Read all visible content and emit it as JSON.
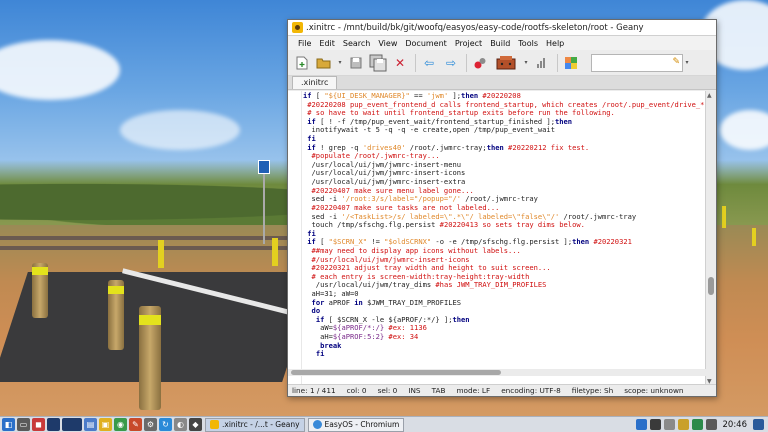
{
  "window": {
    "title": ".xinitrc - /mnt/build/bk/git/woofq/easyos/easy-code/rootfs-skeleton/root - Geany"
  },
  "menu": [
    "File",
    "Edit",
    "Search",
    "View",
    "Document",
    "Project",
    "Build",
    "Tools",
    "Help"
  ],
  "toolbar": {
    "icons": [
      "new-file-icon",
      "open-file-icon",
      "save-icon",
      "close-icon",
      "save-all-icon",
      "back-icon",
      "forward-icon",
      "compile-icon",
      "build-icon",
      "run-icon",
      "color-chooser-icon"
    ],
    "search_value": ""
  },
  "tab": {
    "label": ".xinitrc"
  },
  "code_lines": [
    [
      [
        "k",
        "if"
      ],
      [
        "n",
        " [ "
      ],
      [
        "s",
        "\"${UI_DESK_MANAGER}\""
      ],
      [
        "n",
        " == "
      ],
      [
        "s",
        "'jwm'"
      ],
      [
        "n",
        " ];"
      ],
      [
        "k",
        "then"
      ],
      [
        "c",
        " #20220208"
      ]
    ],
    [
      [
        "c",
        " #20220208 pup_event_frontend_d calls frontend_startup, which creates /root/.pup_event/drive_*"
      ]
    ],
    [
      [
        "c",
        " # so have to wait until frontend_startup exits before run the following."
      ]
    ],
    [
      [
        "n",
        " "
      ],
      [
        "k",
        "if"
      ],
      [
        "n",
        " [ ! -f /tmp/pup_event_wait/frontend_startup_finished ];"
      ],
      [
        "k",
        "then"
      ]
    ],
    [
      [
        "n",
        "  inotifywait -t 5 -q -q -e create,open /tmp/pup_event_wait"
      ]
    ],
    [
      [
        "n",
        " "
      ],
      [
        "k",
        "fi"
      ]
    ],
    [
      [
        "n",
        " "
      ],
      [
        "k",
        "if"
      ],
      [
        "n",
        " ! grep -q "
      ],
      [
        "s",
        "'drives40'"
      ],
      [
        "n",
        " /root/.jwmrc-tray;"
      ],
      [
        "k",
        "then"
      ],
      [
        "c",
        " #20220212 fix test."
      ]
    ],
    [
      [
        "c",
        "  #populate /root/.jwmrc-tray..."
      ]
    ],
    [
      [
        "n",
        "  /usr/local/ui/jwm/jwmrc-insert-menu"
      ]
    ],
    [
      [
        "n",
        "  /usr/local/ui/jwm/jwmrc-insert-icons"
      ]
    ],
    [
      [
        "n",
        "  /usr/local/ui/jwm/jwmrc-insert-extra"
      ]
    ],
    [
      [
        "c",
        "  #20220407 make sure menu label gone..."
      ]
    ],
    [
      [
        "n",
        "  sed -i "
      ],
      [
        "s",
        "'/root:3/s/label=\"/popup=\"/'"
      ],
      [
        "n",
        " /root/.jwmrc-tray"
      ]
    ],
    [
      [
        "c",
        "  #20220407 make sure tasks are not labeled..."
      ]
    ],
    [
      [
        "n",
        "  sed -i "
      ],
      [
        "s",
        "'/<TaskList>/s/ labeled=\\\".*\\\"/ labeled=\\\"false\\\"/'"
      ],
      [
        "n",
        " /root/.jwmrc-tray"
      ]
    ],
    [
      [
        "n",
        "  touch /tmp/sfschg.flg.persist "
      ],
      [
        "c",
        "#20220413 so sets tray dims below."
      ]
    ],
    [
      [
        "n",
        " "
      ],
      [
        "k",
        "fi"
      ]
    ],
    [
      [
        "n",
        " "
      ],
      [
        "k",
        "if"
      ],
      [
        "n",
        " [ "
      ],
      [
        "s",
        "\"$SCRN_X\""
      ],
      [
        "n",
        " != "
      ],
      [
        "s",
        "\"$oldSCRNX\""
      ],
      [
        "n",
        " -o -e /tmp/sfschg.flg.persist ];"
      ],
      [
        "k",
        "then"
      ],
      [
        "c",
        " #20220321"
      ]
    ],
    [
      [
        "c",
        "  ##may need to display app icons without labels..."
      ]
    ],
    [
      [
        "c",
        "  #/usr/local/ui/jwm/jwmrc-insert-icons"
      ]
    ],
    [
      [
        "c",
        "  #20220321 adjust tray width and height to suit screen..."
      ]
    ],
    [
      [
        "c",
        "  # each entry is screen-width:tray-height:tray-width"
      ]
    ],
    [
      [
        "n",
        "   /usr/local/ui/jwm/tray_dims "
      ],
      [
        "c",
        "#has JWM_TRAY_DIM_PROFILES"
      ]
    ],
    [
      [
        "n",
        "  aH=31; aW=0"
      ]
    ],
    [
      [
        "n",
        "  "
      ],
      [
        "k",
        "for"
      ],
      [
        "n",
        " aPROF "
      ],
      [
        "k",
        "in"
      ],
      [
        "n",
        " $JWM_TRAY_DIM_PROFILES"
      ]
    ],
    [
      [
        "n",
        "  "
      ],
      [
        "k",
        "do"
      ]
    ],
    [
      [
        "n",
        "   "
      ],
      [
        "k",
        "if"
      ],
      [
        "n",
        " [ $SCRN_X -le ${aPROF/:*/} ];"
      ],
      [
        "k",
        "then"
      ]
    ],
    [
      [
        "n",
        "    aW="
      ],
      [
        "v",
        "${aPROF/*:/}"
      ],
      [
        "c",
        " #ex: 1136"
      ]
    ],
    [
      [
        "n",
        "    aH="
      ],
      [
        "v",
        "${aPROF:5:2}"
      ],
      [
        "c",
        " #ex: 34"
      ]
    ],
    [
      [
        "n",
        "    "
      ],
      [
        "k",
        "break"
      ]
    ],
    [
      [
        "n",
        "   "
      ],
      [
        "k",
        "fi"
      ]
    ]
  ],
  "status": {
    "line": "line: 1 / 411",
    "col": "col: 0",
    "sel": "sel: 0",
    "ins": "INS",
    "tab": "TAB",
    "mode": "mode: LF",
    "encoding": "encoding: UTF-8",
    "filetype": "filetype: Sh",
    "scope": "scope: unknown"
  },
  "taskbar": {
    "tasks": [
      {
        "label": ".xinitrc - /...t - Geany",
        "active": true
      },
      {
        "label": "EasyOS - Chromium",
        "active": false
      }
    ],
    "clock": "20:46"
  },
  "colors": {
    "keyword": "#00007f",
    "comment": "#d01010",
    "string": "#e0882a",
    "taskbar": "#d9dde4"
  }
}
